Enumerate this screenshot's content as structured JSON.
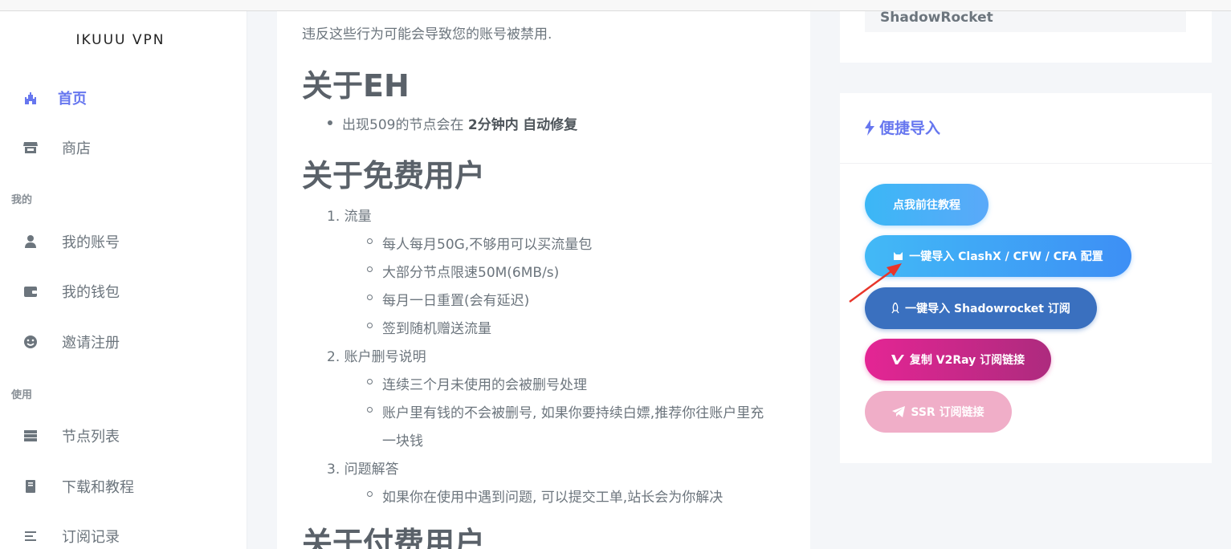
{
  "brand": "IKUUU VPN",
  "sidebar": {
    "items": [
      {
        "label": "首页",
        "icon": "castle-icon"
      },
      {
        "label": "商店",
        "icon": "store-icon"
      },
      {
        "label": "我的账号",
        "icon": "user-icon"
      },
      {
        "label": "我的钱包",
        "icon": "wallet-icon"
      },
      {
        "label": "邀请注册",
        "icon": "smile-icon"
      },
      {
        "label": "节点列表",
        "icon": "server-icon"
      },
      {
        "label": "下载和教程",
        "icon": "book-icon"
      },
      {
        "label": "订阅记录",
        "icon": "list-icon"
      }
    ],
    "sections": [
      "我的",
      "使用"
    ]
  },
  "content": {
    "warning_text": "违反这些行为可能会导致您的账号被禁用.",
    "eh_heading": "关于EH",
    "eh_item_prefix": "出现509的节点会在 ",
    "eh_item_bold1": "2分钟内",
    "eh_item_bold2": "自动修复",
    "free_heading": "关于免费用户",
    "free_list": [
      {
        "num": "1.",
        "title": "流量",
        "subs": [
          "每人每月50G,不够用可以买流量包",
          "大部分节点限速50M(6MB/s)",
          "每月一日重置(会有延迟)",
          "签到随机赠送流量"
        ]
      },
      {
        "num": "2.",
        "title": "账户删号说明",
        "subs": [
          "连续三个月未使用的会被删号处理",
          "账户里有钱的不会被删号, 如果你要持续白嫖,推荐你往账户里充",
          "一块钱"
        ]
      },
      {
        "num": "3.",
        "title": "问题解答",
        "subs": [
          "如果你在使用中遇到问题, 可以提交工单,站长会为你解决"
        ]
      }
    ],
    "paid_heading": "关于付费用户"
  },
  "right": {
    "top_label": "ShadowRocket",
    "import_title": "便捷导入",
    "buttons": [
      {
        "label": "点我前往教程"
      },
      {
        "label": "一键导入 ClashX / CFW / CFA 配置",
        "icon": "cat-icon"
      },
      {
        "label": "一键导入 Shadowrocket 订阅",
        "icon": "rocket-icon"
      },
      {
        "label": "复制 V2Ray 订阅链接",
        "icon": "v-icon"
      },
      {
        "label": "SSR 订阅链接",
        "icon": "paper-plane-icon"
      }
    ]
  },
  "colors": {
    "accent": "#6777ef",
    "annotation_arrow": "#e8352a"
  }
}
